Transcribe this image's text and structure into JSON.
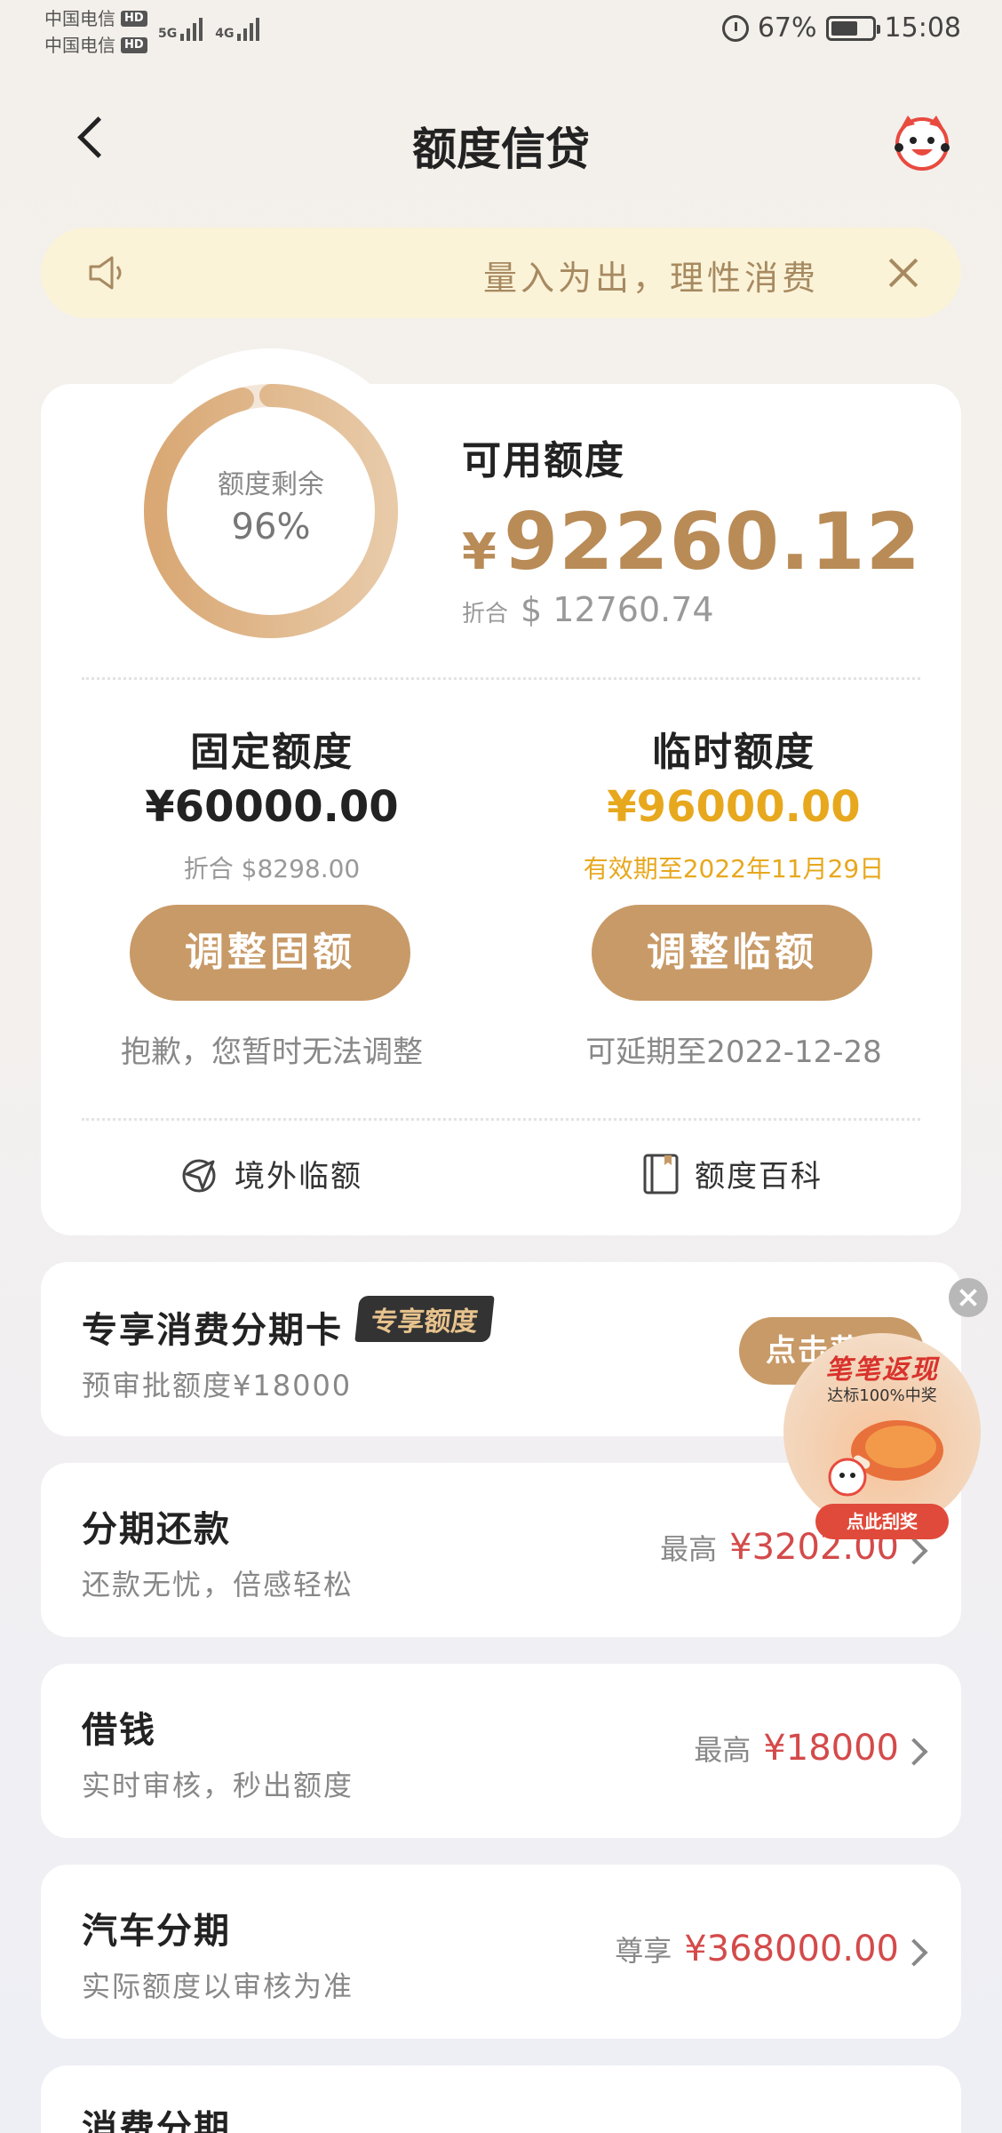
{
  "status_bar": {
    "carrier1": "中国电信",
    "carrier2": "中国电信",
    "hd": "HD",
    "net1": "5G",
    "net2": "4G",
    "battery": "67%",
    "time": "15:08"
  },
  "header": {
    "title": "额度信贷"
  },
  "notice": {
    "text": "量入为出，理性消费"
  },
  "credit": {
    "ring_label": "额度剩余",
    "ring_value": "96%",
    "ring_fraction": 0.96,
    "available_label": "可用额度",
    "available_currency": "¥",
    "available_amount": "92260.12",
    "equiv_prefix": "折合",
    "equiv_amount": "$ 12760.74",
    "fixed": {
      "title": "固定额度",
      "amount": "¥60000.00",
      "sub": "折合 $8298.00",
      "button": "调整固额",
      "note": "抱歉，您暂时无法调整"
    },
    "temporary": {
      "title": "临时额度",
      "amount": "¥96000.00",
      "sub": "有效期至2022年11月29日",
      "button": "调整临额",
      "note": "可延期至2022-12-28"
    },
    "links": {
      "overseas": "境外临额",
      "encyclopedia": "额度百科"
    }
  },
  "cards": {
    "installment_card": {
      "title": "专享消费分期卡",
      "badge": "专享额度",
      "sub": "预审批额度¥18000",
      "button": "点击获"
    },
    "repay": {
      "title": "分期还款",
      "sub": "还款无忧，倍感轻松",
      "prefix": "最高",
      "value": "¥3202.00"
    },
    "borrow": {
      "title": "借钱",
      "sub": "实时审核，秒出额度",
      "prefix": "最高",
      "value": "¥18000"
    },
    "car": {
      "title": "汽车分期",
      "sub": "实际额度以审核为准",
      "prefix": "尊享",
      "value": "¥368000.00"
    },
    "consumer": {
      "title": "消费分期"
    }
  },
  "promo": {
    "title": "笔笔返现",
    "sub": "达标100%中奖",
    "button": "点此刮奖"
  },
  "colors": {
    "gold": "#c89a67",
    "amount_gold": "#b98b57",
    "temp_yellow": "#e7a81e",
    "red": "#d44a4a"
  }
}
